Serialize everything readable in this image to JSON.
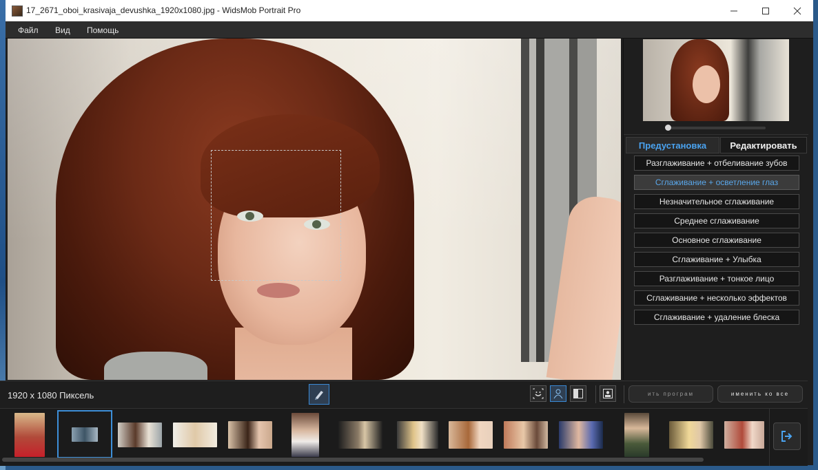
{
  "window": {
    "title": "17_2671_oboi_krasivaja_devushka_1920x1080.jpg - WidsMob Portrait Pro",
    "controls": {
      "minimize": "—",
      "maximize": "☐",
      "close": "✕"
    }
  },
  "menu": [
    "Файл",
    "Вид",
    "Помощь"
  ],
  "tabs": {
    "preset": "Предустановка",
    "edit": "Редактировать"
  },
  "presets": [
    "Разглаживание + отбеливание зубов",
    "Сглаживание + осветление глаз",
    "Незначительное сглаживание",
    "Среднее сглаживание",
    "Основное сглаживание",
    "Сглаживание + Улыбка",
    "Разглаживание + тонкое лицо",
    "Сглаживание + несколько эффектов",
    "Сглаживание + удаление блеска"
  ],
  "active_preset_index": 1,
  "status": {
    "dimensions": "1920 x 1080 Пиксель",
    "apply_button": "ить програм",
    "apply_all_button": "именить ко все"
  },
  "icons": {
    "app": "app-icon",
    "compare": "pen-icon",
    "face": "smile-face-icon",
    "person": "person-icon",
    "split": "split-view-icon",
    "portrait": "portrait-icon",
    "export": "export-icon"
  },
  "colors": {
    "accent": "#4aa3f0",
    "selected_border": "#3d8fd9"
  }
}
